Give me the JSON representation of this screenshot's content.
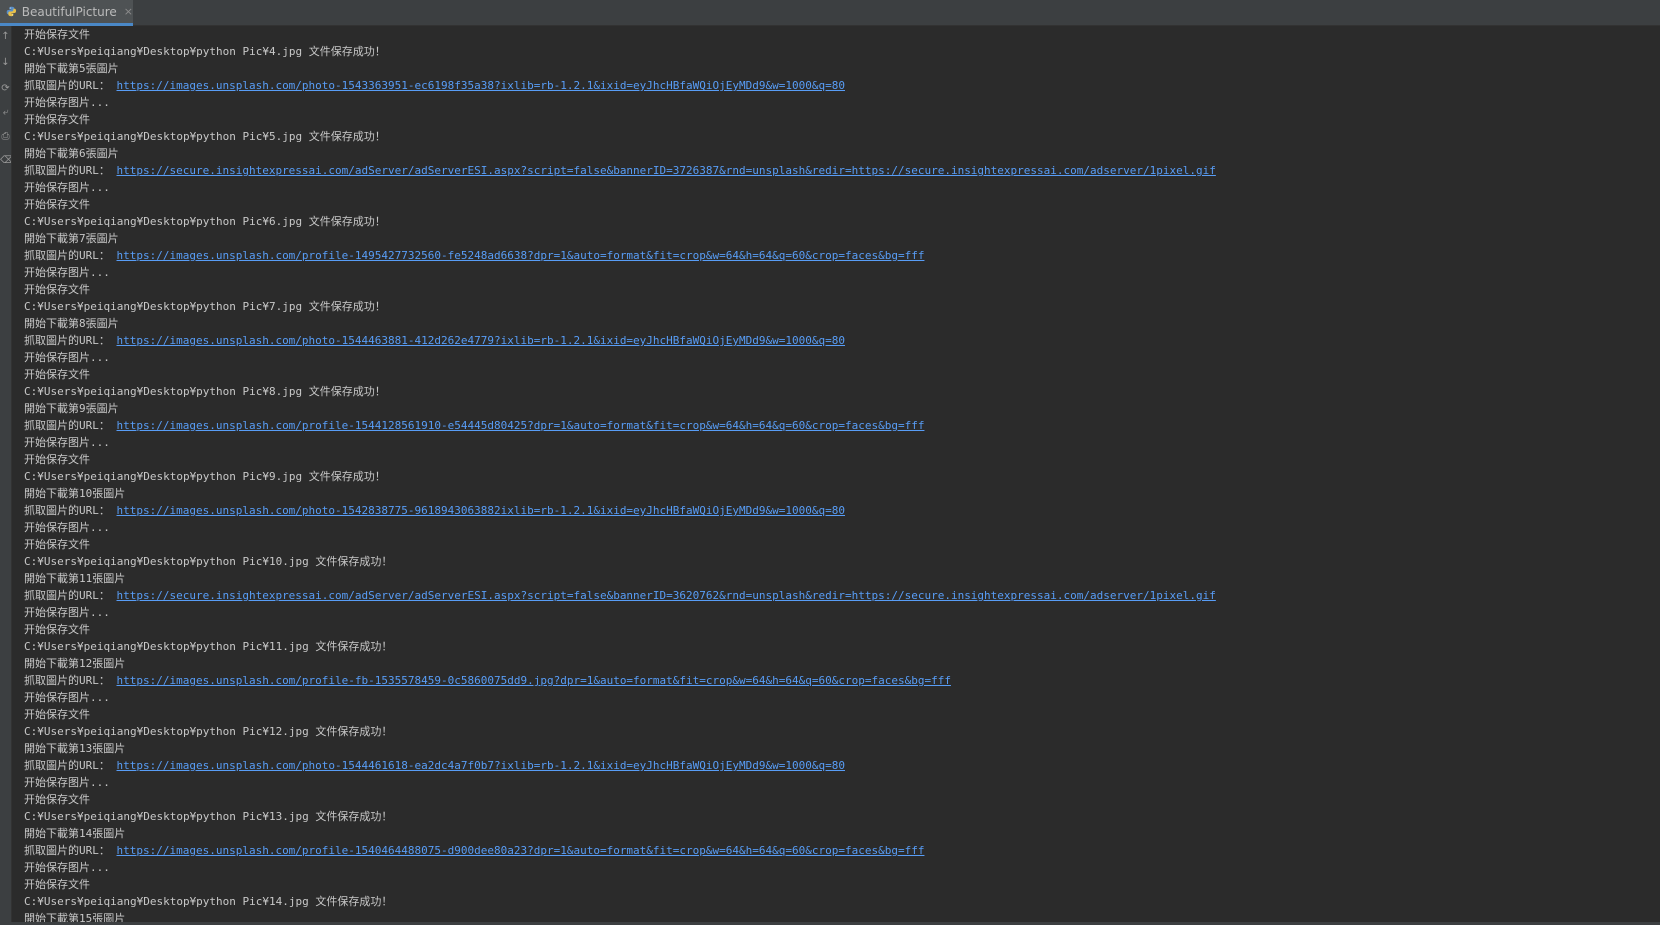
{
  "tab": {
    "title": "BeautifulPicture",
    "close": "×",
    "icon": "python-icon"
  },
  "gutter_tools": [
    {
      "icon": "arrow-up-icon",
      "glyph": "↑"
    },
    {
      "icon": "arrow-down-icon",
      "glyph": "↓"
    },
    {
      "icon": "rerun-icon",
      "glyph": "⟳"
    },
    {
      "icon": "soft-wrap-icon",
      "glyph": "⤶"
    },
    {
      "icon": "print-icon",
      "glyph": "⎙"
    },
    {
      "icon": "clear-icon",
      "glyph": "⌫"
    }
  ],
  "colors": {
    "background": "#2b2b2b",
    "text": "#c8c8c8",
    "link": "#589df6",
    "tab_bg": "#3c3f41"
  },
  "console_lines": [
    {
      "prefix": "开始保存文件"
    },
    {
      "prefix": "C:¥Users¥peiqiang¥Desktop¥python Pic¥4.jpg 文件保存成功！"
    },
    {
      "prefix": "開始下載第5張圖片"
    },
    {
      "prefix": "抓取圖片的URL： ",
      "url": "https://images.unsplash.com/photo-1543363951-ec6198f35a38?ixlib=rb-1.2.1&ixid=eyJhcHBfaWQiOjEyMDd9&w=1000&q=80"
    },
    {
      "prefix": "开始保存图片..."
    },
    {
      "prefix": "开始保存文件"
    },
    {
      "prefix": "C:¥Users¥peiqiang¥Desktop¥python Pic¥5.jpg 文件保存成功！"
    },
    {
      "prefix": "開始下載第6張圖片"
    },
    {
      "prefix": "抓取圖片的URL： ",
      "url": "https://secure.insightexpressai.com/adServer/adServerESI.aspx?script=false&bannerID=3726387&rnd=unsplash&redir=https://secure.insightexpressai.com/adserver/1pixel.gif"
    },
    {
      "prefix": "开始保存图片..."
    },
    {
      "prefix": "开始保存文件"
    },
    {
      "prefix": "C:¥Users¥peiqiang¥Desktop¥python Pic¥6.jpg 文件保存成功！"
    },
    {
      "prefix": "開始下載第7張圖片"
    },
    {
      "prefix": "抓取圖片的URL： ",
      "url": "https://images.unsplash.com/profile-1495427732560-fe5248ad6638?dpr=1&auto=format&fit=crop&w=64&h=64&q=60&crop=faces&bg=fff"
    },
    {
      "prefix": "开始保存图片..."
    },
    {
      "prefix": "开始保存文件"
    },
    {
      "prefix": "C:¥Users¥peiqiang¥Desktop¥python Pic¥7.jpg 文件保存成功！"
    },
    {
      "prefix": "開始下載第8張圖片"
    },
    {
      "prefix": "抓取圖片的URL： ",
      "url": "https://images.unsplash.com/photo-1544463881-412d262e4779?ixlib=rb-1.2.1&ixid=eyJhcHBfaWQiOjEyMDd9&w=1000&q=80"
    },
    {
      "prefix": "开始保存图片..."
    },
    {
      "prefix": "开始保存文件"
    },
    {
      "prefix": "C:¥Users¥peiqiang¥Desktop¥python Pic¥8.jpg 文件保存成功！"
    },
    {
      "prefix": "開始下載第9張圖片"
    },
    {
      "prefix": "抓取圖片的URL： ",
      "url": "https://images.unsplash.com/profile-1544128561910-e54445d80425?dpr=1&auto=format&fit=crop&w=64&h=64&q=60&crop=faces&bg=fff"
    },
    {
      "prefix": "开始保存图片..."
    },
    {
      "prefix": "开始保存文件"
    },
    {
      "prefix": "C:¥Users¥peiqiang¥Desktop¥python Pic¥9.jpg 文件保存成功！"
    },
    {
      "prefix": "開始下載第10張圖片"
    },
    {
      "prefix": "抓取圖片的URL： ",
      "url": "https://images.unsplash.com/photo-1542838775-9618943063882ixlib=rb-1.2.1&ixid=eyJhcHBfaWQiOjEyMDd9&w=1000&q=80"
    },
    {
      "prefix": "开始保存图片..."
    },
    {
      "prefix": "开始保存文件"
    },
    {
      "prefix": "C:¥Users¥peiqiang¥Desktop¥python Pic¥10.jpg 文件保存成功！"
    },
    {
      "prefix": "開始下載第11張圖片"
    },
    {
      "prefix": "抓取圖片的URL： ",
      "url": "https://secure.insightexpressai.com/adServer/adServerESI.aspx?script=false&bannerID=3620762&rnd=unsplash&redir=https://secure.insightexpressai.com/adserver/1pixel.gif"
    },
    {
      "prefix": "开始保存图片..."
    },
    {
      "prefix": "开始保存文件"
    },
    {
      "prefix": "C:¥Users¥peiqiang¥Desktop¥python Pic¥11.jpg 文件保存成功！"
    },
    {
      "prefix": "開始下載第12張圖片"
    },
    {
      "prefix": "抓取圖片的URL： ",
      "url": "https://images.unsplash.com/profile-fb-1535578459-0c5860075dd9.jpg?dpr=1&auto=format&fit=crop&w=64&h=64&q=60&crop=faces&bg=fff"
    },
    {
      "prefix": "开始保存图片..."
    },
    {
      "prefix": "开始保存文件"
    },
    {
      "prefix": "C:¥Users¥peiqiang¥Desktop¥python Pic¥12.jpg 文件保存成功！"
    },
    {
      "prefix": "開始下載第13張圖片"
    },
    {
      "prefix": "抓取圖片的URL： ",
      "url": "https://images.unsplash.com/photo-1544461618-ea2dc4a7f0b7?ixlib=rb-1.2.1&ixid=eyJhcHBfaWQiOjEyMDd9&w=1000&q=80"
    },
    {
      "prefix": "开始保存图片..."
    },
    {
      "prefix": "开始保存文件"
    },
    {
      "prefix": "C:¥Users¥peiqiang¥Desktop¥python Pic¥13.jpg 文件保存成功！"
    },
    {
      "prefix": "開始下載第14張圖片"
    },
    {
      "prefix": "抓取圖片的URL： ",
      "url": "https://images.unsplash.com/profile-1540464488075-d900dee80a23?dpr=1&auto=format&fit=crop&w=64&h=64&q=60&crop=faces&bg=fff"
    },
    {
      "prefix": "开始保存图片..."
    },
    {
      "prefix": "开始保存文件"
    },
    {
      "prefix": "C:¥Users¥peiqiang¥Desktop¥python Pic¥14.jpg 文件保存成功！"
    },
    {
      "prefix": "開始下載第15張圖片"
    }
  ]
}
